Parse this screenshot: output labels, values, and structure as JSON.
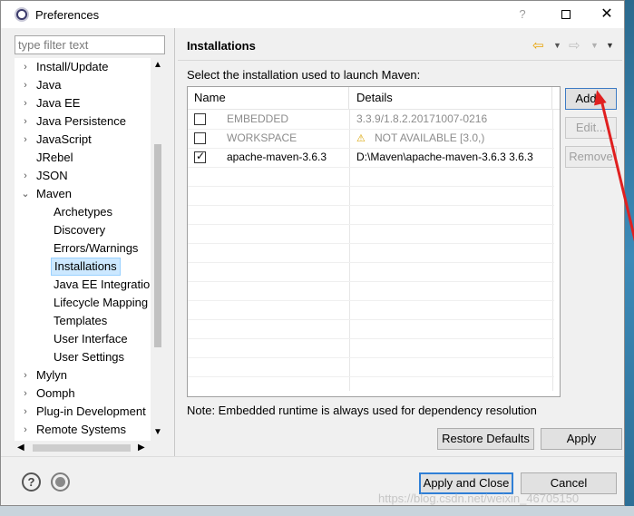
{
  "window": {
    "title": "Preferences",
    "help_glyph": "?",
    "close_glyph": "✕"
  },
  "filter": {
    "placeholder": "type filter text"
  },
  "tree": {
    "items": [
      {
        "label": "Install/Update"
      },
      {
        "label": "Java"
      },
      {
        "label": "Java EE"
      },
      {
        "label": "Java Persistence"
      },
      {
        "label": "JavaScript"
      },
      {
        "label": "JRebel"
      },
      {
        "label": "JSON"
      },
      {
        "label": "Maven"
      },
      {
        "label": "Archetypes"
      },
      {
        "label": "Discovery"
      },
      {
        "label": "Errors/Warnings"
      },
      {
        "label": "Installations"
      },
      {
        "label": "Java EE Integration"
      },
      {
        "label": "Lifecycle Mapping"
      },
      {
        "label": "Templates"
      },
      {
        "label": "User Interface"
      },
      {
        "label": "User Settings"
      },
      {
        "label": "Mylyn"
      },
      {
        "label": "Oomph"
      },
      {
        "label": "Plug-in Development"
      },
      {
        "label": "Remote Systems"
      }
    ],
    "selected": "Installations"
  },
  "pane": {
    "title": "Installations",
    "description": "Select the installation used to launch Maven:",
    "table": {
      "headers": {
        "name": "Name",
        "details": "Details"
      },
      "rows": [
        {
          "checked": false,
          "name": "EMBEDDED",
          "details": "3.3.9/1.8.2.20171007-0216",
          "dimmed": true,
          "warning": false
        },
        {
          "checked": false,
          "name": "WORKSPACE",
          "details": "NOT AVAILABLE [3.0,)",
          "dimmed": true,
          "warning": true
        },
        {
          "checked": true,
          "name": "apache-maven-3.6.3",
          "details": "D:\\Maven\\apache-maven-3.6.3 3.6.3",
          "dimmed": false,
          "warning": false
        }
      ]
    },
    "buttons": {
      "add": "Add...",
      "edit": "Edit...",
      "remove": "Remove"
    },
    "note": "Note: Embedded runtime is always used for dependency resolution",
    "restore_defaults": "Restore Defaults",
    "apply": "Apply"
  },
  "footer": {
    "apply_and_close": "Apply and Close",
    "cancel": "Cancel",
    "help_icon_glyph": "?"
  },
  "watermark": "https://blog.csdn.net/weixin_46705150",
  "colors": {
    "annotation_arrow": "#e02020",
    "warning": "#d9a300",
    "default_button_border": "#2f7fd6",
    "nav_back": "#e8a100"
  },
  "icons": {
    "app": "eclipse-icon",
    "nav_back": "arrow-left-icon",
    "nav_forward": "arrow-right-icon",
    "warning": "warning-icon",
    "help": "help-icon",
    "record": "record-macro-icon"
  }
}
